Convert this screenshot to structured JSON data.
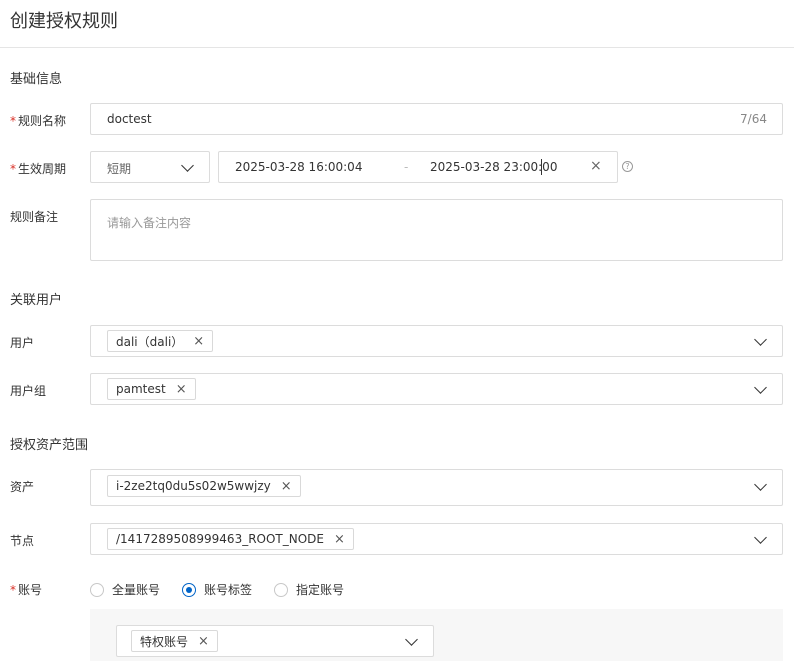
{
  "page": {
    "title": "创建授权规则"
  },
  "basic": {
    "section_title": "基础信息",
    "rule_name": {
      "label": "规则名称",
      "required_mark": "*",
      "value": "doctest",
      "counter": "7/64"
    },
    "period": {
      "label": "生效周期",
      "required_mark": "*",
      "type_value": "短期",
      "start": "2025-03-28 16:00:04",
      "separator": "-",
      "end": "2025-03-28 23:00:00",
      "clear": "×",
      "help": "?"
    },
    "note": {
      "label": "规则备注",
      "placeholder": "请输入备注内容"
    }
  },
  "users": {
    "section_title": "关联用户",
    "user": {
      "label": "用户",
      "tags": [
        "dali（dali）"
      ]
    },
    "group": {
      "label": "用户组",
      "tags": [
        "pamtest"
      ]
    }
  },
  "assets": {
    "section_title": "授权资产范围",
    "asset": {
      "label": "资产",
      "tags": [
        "i-2ze2tq0du5s02w5wwjzy"
      ]
    },
    "node": {
      "label": "节点",
      "tags": [
        "/1417289508999463_ROOT_NODE"
      ]
    },
    "account": {
      "label": "账号",
      "required_mark": "*",
      "options": [
        {
          "label": "全量账号",
          "checked": false
        },
        {
          "label": "账号标签",
          "checked": true
        },
        {
          "label": "指定账号",
          "checked": false
        }
      ],
      "tag_select": {
        "tags": [
          "特权账号"
        ]
      }
    }
  },
  "icons": {
    "remove": "×",
    "dropdown": "chevron-down-icon"
  },
  "colors": {
    "accent": "#0064c8",
    "required": "#d93026",
    "border": "#dcdcdc"
  }
}
